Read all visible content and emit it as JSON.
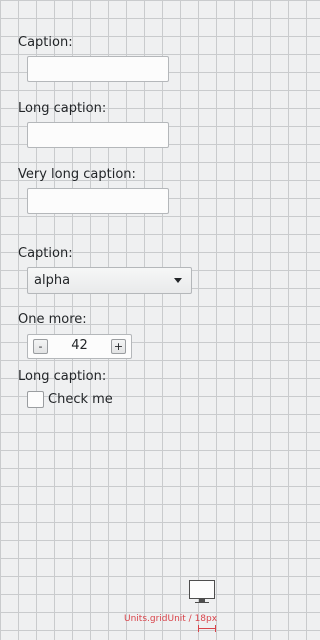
{
  "form": {
    "caption_1": "Caption:",
    "caption_2": "Long caption:",
    "caption_3": "Very long caption:",
    "caption_4": "Caption:",
    "caption_5": "One more:",
    "caption_6": "Long caption:",
    "text_field_1": {
      "value": "",
      "placeholder": ""
    },
    "text_field_2": {
      "value": "",
      "placeholder": ""
    },
    "text_field_3": {
      "value": "",
      "placeholder": ""
    },
    "combo": {
      "selected": "alpha",
      "icon": "chevron-down-icon"
    },
    "spinbox": {
      "value": "42",
      "decrement_label": "-",
      "increment_label": "+"
    },
    "checkbox": {
      "label": "Check me",
      "checked": false
    }
  },
  "units_indicator": {
    "label": "Units.gridUnit / 18px",
    "icon": "monitor-icon",
    "color": "#d9434a"
  }
}
